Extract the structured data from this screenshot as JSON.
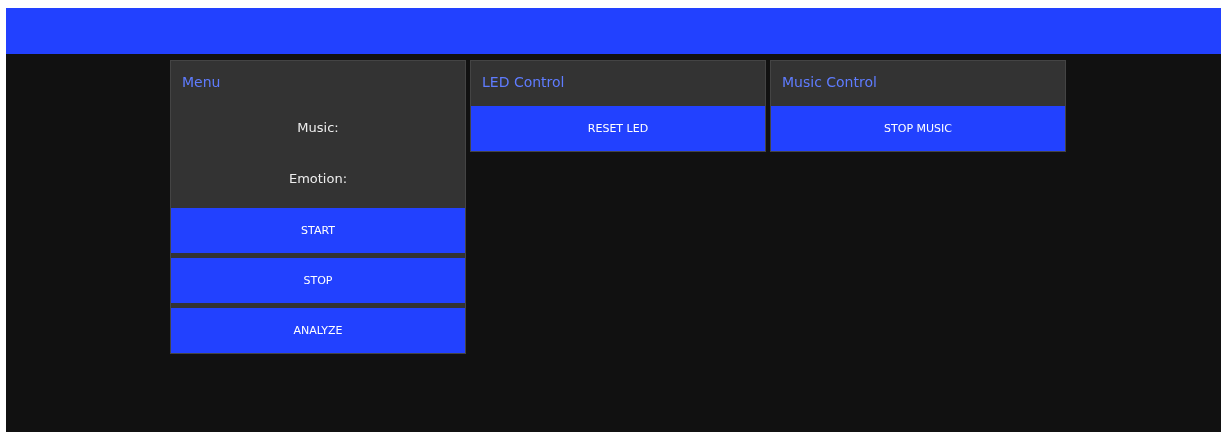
{
  "panels": [
    {
      "title": "Menu",
      "labels": [
        "Music:",
        "Emotion:"
      ],
      "buttons": [
        "START",
        "STOP",
        "ANALYZE"
      ]
    },
    {
      "title": "LED Control",
      "buttons": [
        "RESET LED"
      ]
    },
    {
      "title": "Music Control",
      "buttons": [
        "STOP MUSIC"
      ]
    }
  ]
}
